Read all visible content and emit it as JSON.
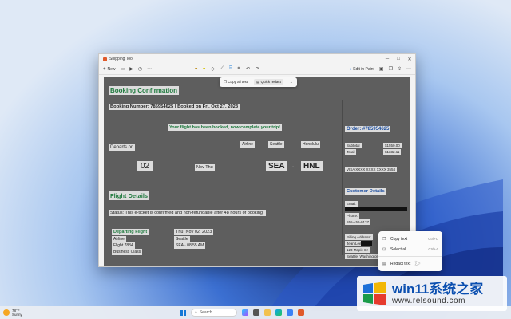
{
  "window": {
    "title": "Snipping Tool",
    "controls": [
      "minimize-icon",
      "maximize-icon",
      "close-icon"
    ]
  },
  "toolbar": {
    "new_label": "New",
    "edit_in_paint_label": "Edit in Paint"
  },
  "text_actions": {
    "copy_all_label": "Copy all text",
    "quick_redact_label": "Quick redact"
  },
  "screenshot": {
    "booking_title": "Booking Confirmation",
    "booking_number": "Booking Number: 785954625 | Booked on Fri. Oct 27, 2023",
    "flight_banner": "Your flight has been booked, now complete your trip!",
    "route_header": {
      "airline": "Airline",
      "from": "Seattle",
      "to": "Honolulu"
    },
    "departs_on_label": "Departs on",
    "departs_day": "02",
    "departs_month": "Nov Thu",
    "from_code": "SEA",
    "to_code": "HNL",
    "flight_details_title": "Flight Details",
    "status_text": "Status: This e-ticket is confirmed and non-refundable after 48 hours of booking.",
    "departing_label": "Departing Flight",
    "airline_label": "Airline",
    "flight_no": "Flight 7834",
    "cabin_class": "Business Class",
    "dep_date": "Thu, Nov 02, 2023",
    "dep_city": "Seattle",
    "dep_time": "SEA · 08:55 AM",
    "order_title": "Order: #785954625",
    "subtotal_label": "Subtotal",
    "subtotal_value": "$1550.00",
    "total_label": "Total",
    "total_value": "$1332.11",
    "card_line": "VISA XXXX XXXX XXXX 3554",
    "customer_title": "Customer Details",
    "email_label": "Email:",
    "phone_label": "Phone:",
    "phone_value": "555-456-0137",
    "billing_label": "Billing Address:",
    "billing_name": "Jean Lee",
    "billing_line1": "123 Maple Dr",
    "billing_line2": "Seattle, Washington"
  },
  "context_menu": {
    "items": [
      {
        "label": "Copy text",
        "shortcut": "Ctrl+C"
      },
      {
        "label": "Select all",
        "shortcut": "Ctrl+A"
      },
      {
        "label": "Redact text",
        "shortcut": ""
      }
    ]
  },
  "taskbar": {
    "temperature": "78°F",
    "condition": "Sunny",
    "search_placeholder": "Search"
  },
  "watermark": {
    "title": "win11系统之家",
    "url": "www.relsound.com"
  },
  "colors": {
    "accent": "#1679d7",
    "highlight_green": "#1f7a3e",
    "highlight_blue": "#1e4fa0"
  }
}
